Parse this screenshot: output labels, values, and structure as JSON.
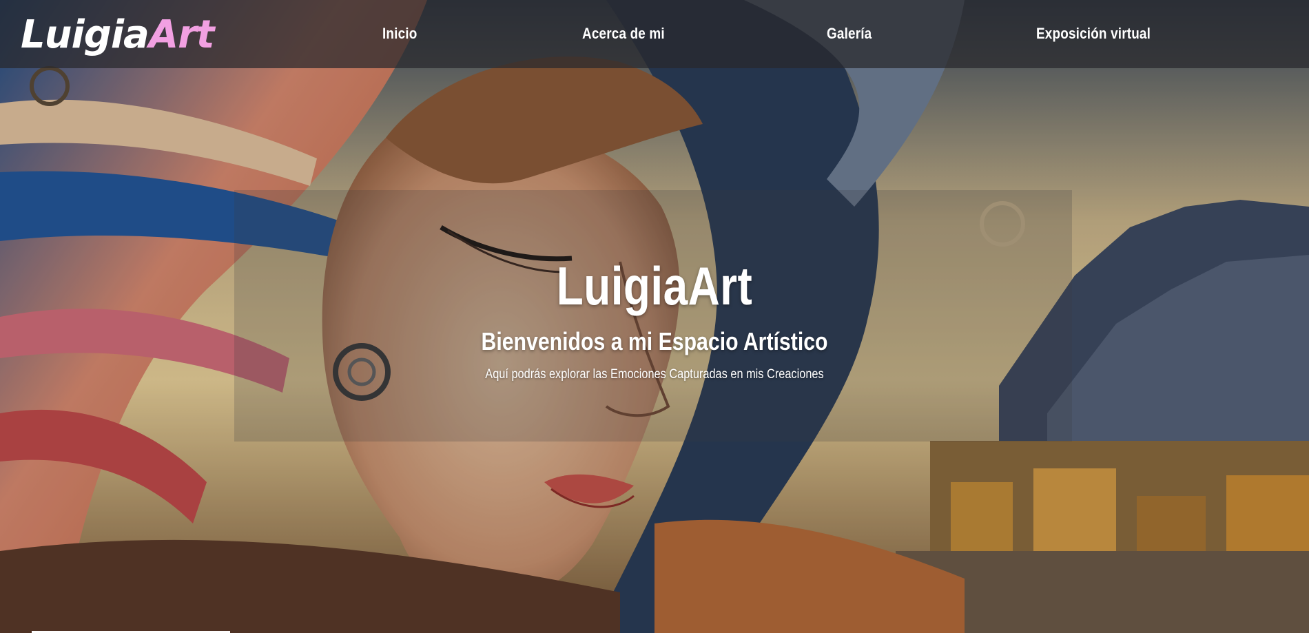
{
  "brand": {
    "logo_part1": "Luigia",
    "logo_part2": "Art",
    "logo_accent_color": "#f2a0e2"
  },
  "nav": {
    "items": [
      {
        "label": "Inicio"
      },
      {
        "label": "Acerca de mi"
      },
      {
        "label": "Galería"
      },
      {
        "label": "Exposición virtual"
      }
    ]
  },
  "hero": {
    "title": "LuigiaArt",
    "subtitle": "Bienvenidos a mi Espacio Artístico",
    "tagline": "Aquí podrás explorar las Emociones Capturadas en mis Creaciones",
    "background_image": "painted-woman-face-landscape"
  }
}
